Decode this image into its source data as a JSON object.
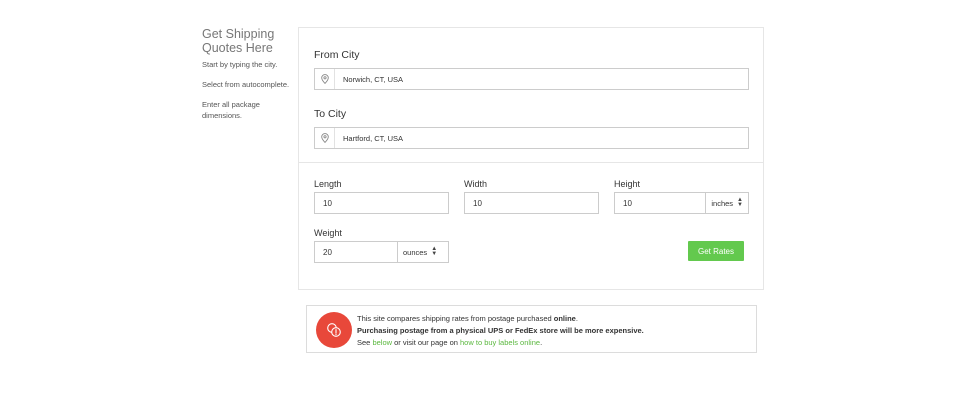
{
  "sidebar": {
    "title_line1": "Get Shipping",
    "title_line2": "Quotes Here",
    "step1": "Start by typing the city.",
    "step2": "Select from autocomplete.",
    "step3": "Enter all package dimensions."
  },
  "form": {
    "from_label": "From City",
    "from_value": "Norwich, CT, USA",
    "to_label": "To City",
    "to_value": "Hartford, CT, USA",
    "length_label": "Length",
    "length_value": "10",
    "width_label": "Width",
    "width_value": "10",
    "height_label": "Height",
    "height_value": "10",
    "dimension_unit": "inches",
    "weight_label": "Weight",
    "weight_value": "20",
    "weight_unit": "ounces",
    "submit_label": "Get Rates"
  },
  "notice": {
    "line1_pre": "This site compares shipping rates from postage purchased ",
    "line1_bold": "online",
    "line1_post": ".",
    "line2_bold": "Purchasing postage from a physical UPS or FedEx store will be more expensive.",
    "line3_pre": "See ",
    "line3_link1": "below",
    "line3_mid": " or visit our page on ",
    "line3_link2": "how to buy labels online",
    "line3_post": "."
  },
  "colors": {
    "accent": "#63c94e",
    "alert": "#e8483a"
  },
  "icons": {
    "location": "map-pin-icon",
    "alert": "coins-info-icon",
    "select": "sort-arrows-icon"
  }
}
